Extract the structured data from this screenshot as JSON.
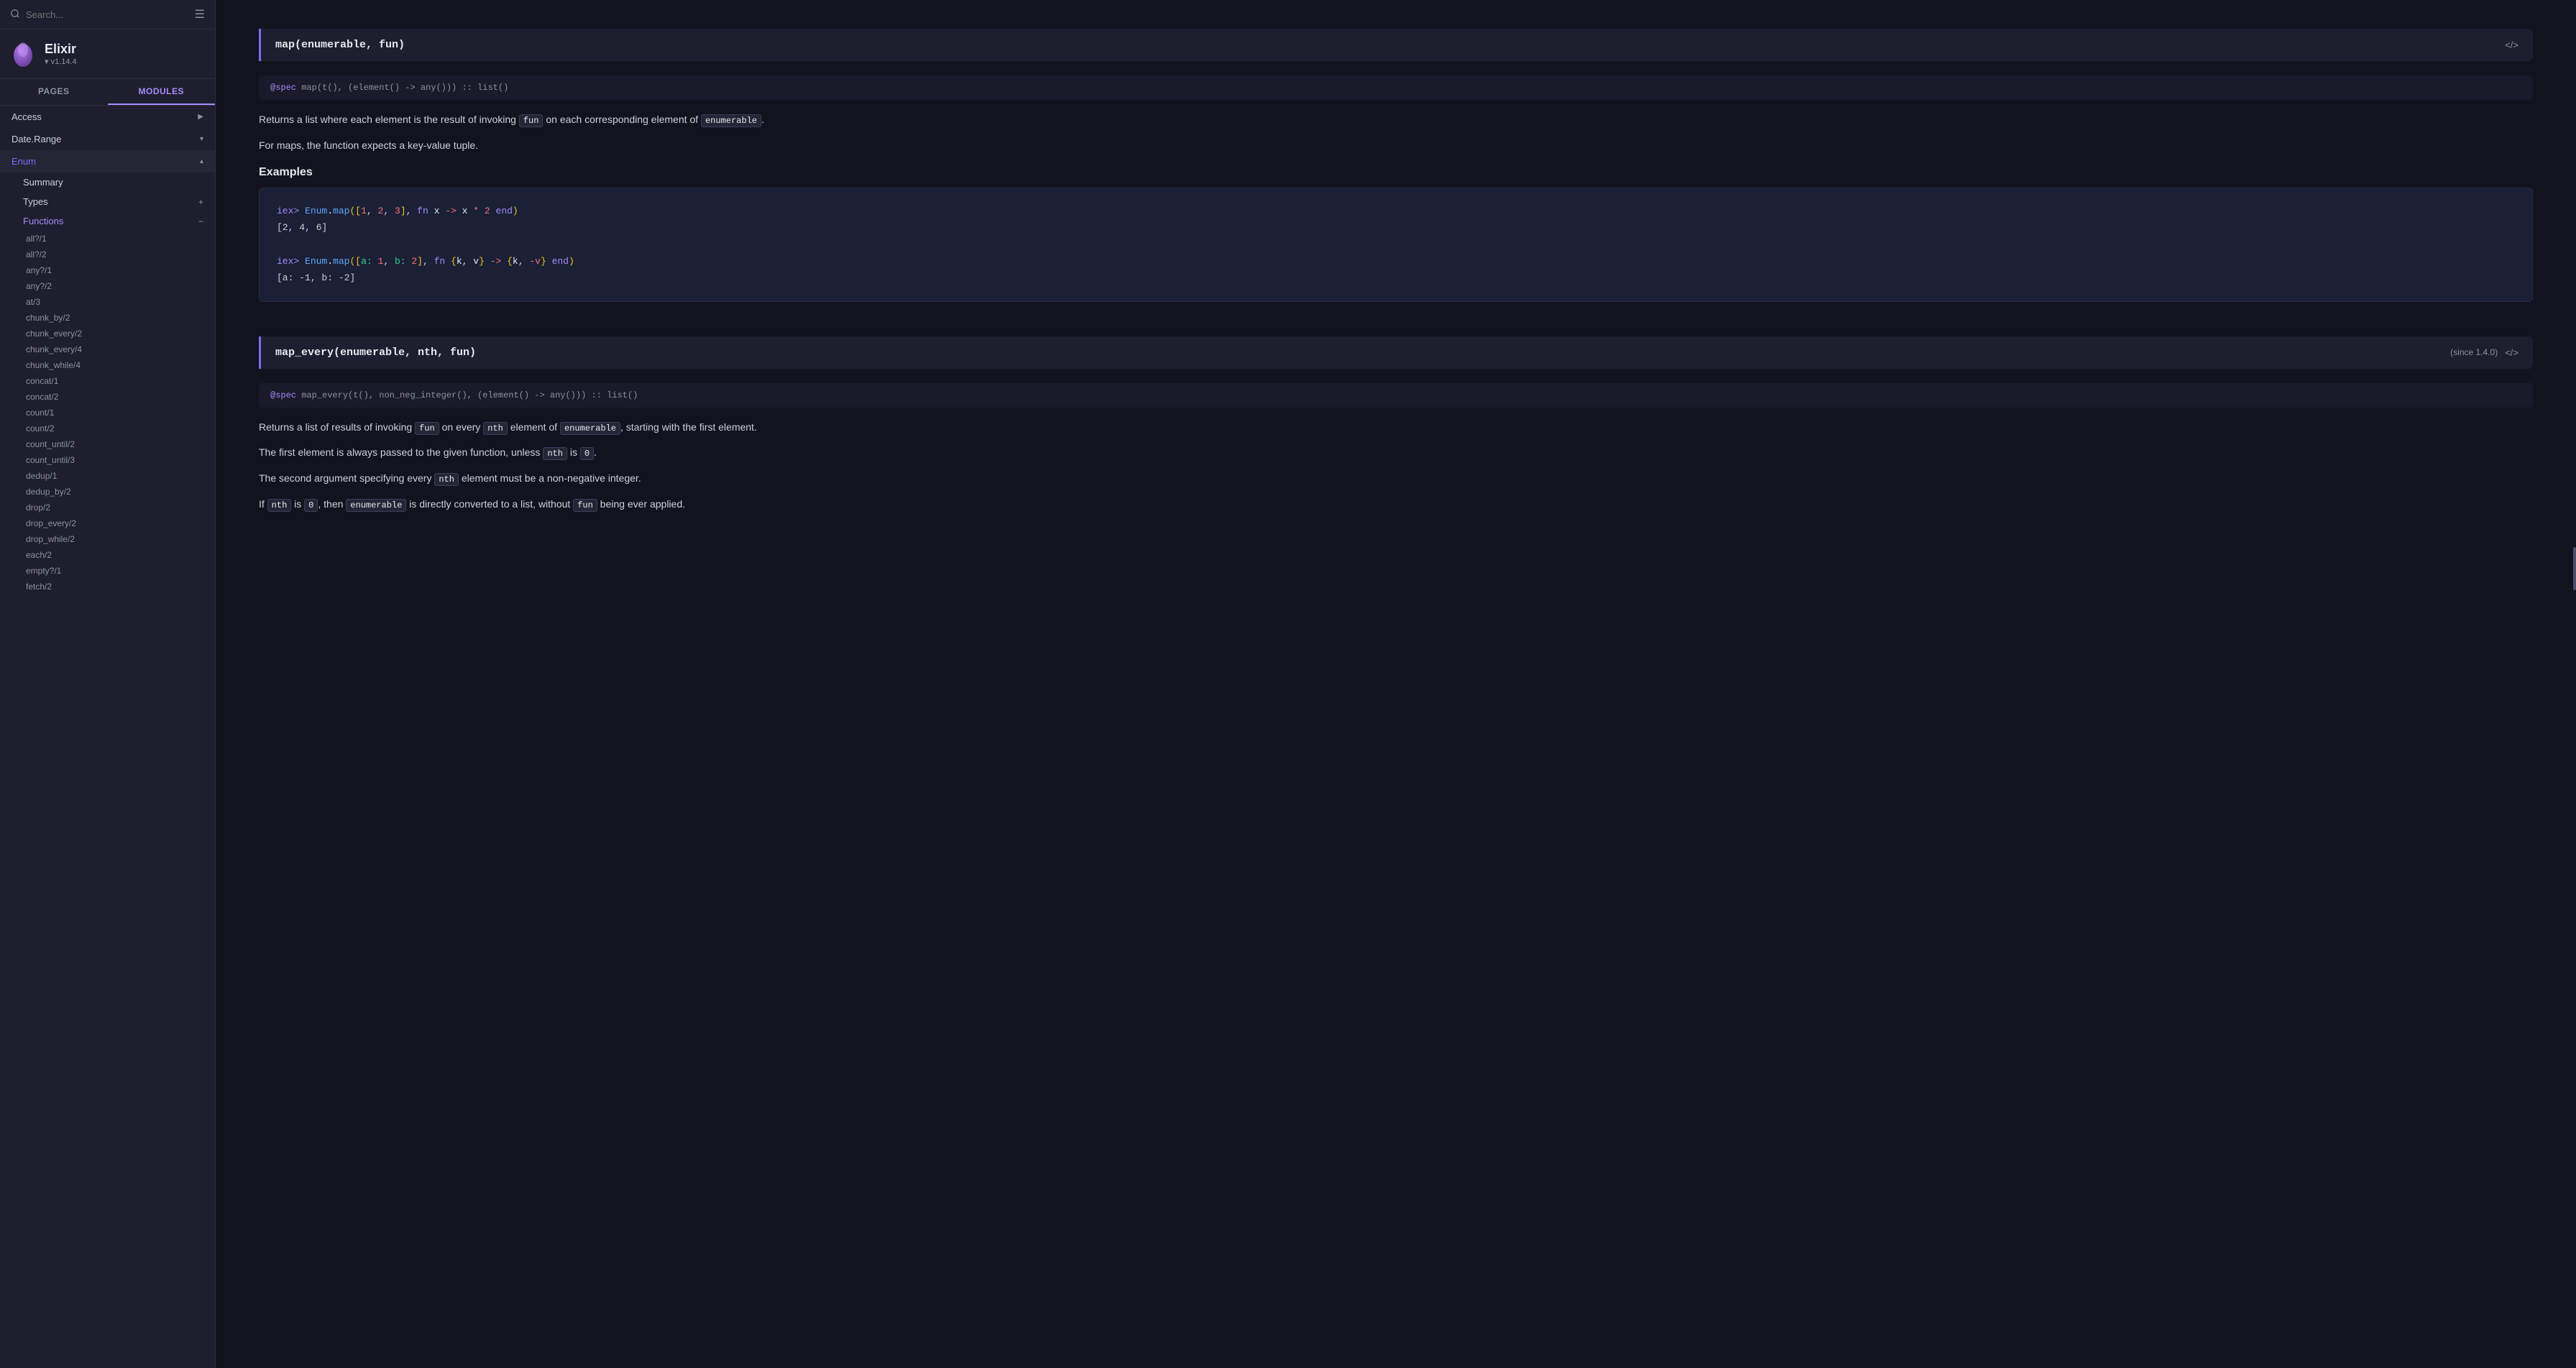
{
  "sidebar": {
    "search_placeholder": "Search...",
    "brand": {
      "name": "Elixir",
      "version": "▾ v1.14.4"
    },
    "tabs": [
      {
        "label": "PAGES",
        "active": false
      },
      {
        "label": "MODULES",
        "active": true
      }
    ],
    "nav_items": [
      {
        "label": "Access",
        "collapsed": true
      },
      {
        "label": "Date.Range",
        "collapsed": true
      },
      {
        "label": "Enum",
        "collapsed": false,
        "active": true
      }
    ],
    "enum_sub_items": [
      {
        "label": "Summary",
        "active": false
      },
      {
        "label": "Types",
        "has_plus": true
      },
      {
        "label": "Functions",
        "has_minus": true,
        "active": true
      }
    ],
    "functions": [
      "all?/1",
      "all?/2",
      "any?/1",
      "any?/2",
      "at/3",
      "chunk_by/2",
      "chunk_every/2",
      "chunk_every/4",
      "chunk_while/4",
      "concat/1",
      "concat/2",
      "count/1",
      "count/2",
      "count_until/2",
      "count_until/3",
      "dedup/1",
      "dedup_by/2",
      "drop/2",
      "drop_every/2",
      "drop_while/2",
      "each/2",
      "empty?/1",
      "fetch/2"
    ]
  },
  "main": {
    "function_blocks": [
      {
        "id": "map",
        "signature": "map(enumerable, fun)",
        "spec": "@spec map(t(), (element() -> any())) :: list()",
        "description_parts": [
          "Returns a list where each element is the result of invoking",
          "fun",
          "on each corresponding element of",
          "enumerable."
        ],
        "for_maps_note": "For maps, the function expects a key-value tuple.",
        "examples_title": "Examples",
        "examples": [
          {
            "input": "iex> Enum.map([1, 2, 3], fn x -> x * 2 end)",
            "output": "[2, 4, 6]"
          },
          {
            "input": "iex> Enum.map([a: 1, b: 2], fn {k, v} -> {k, -v} end)",
            "output": "[a: -1, b: -2]"
          }
        ],
        "since": null,
        "code_link": "</>"
      },
      {
        "id": "map_every",
        "signature": "map_every(enumerable, nth, fun)",
        "spec": "@spec map_every(t(), non_neg_integer(), (element() -> any())) :: list()",
        "since": "(since 1.4.0)",
        "code_link": "</>",
        "description_lines": [
          "Returns a list of results of invoking fun on every nth element of enumerable, starting with the first element.",
          "The first element is always passed to the given function, unless nth is 0.",
          "The second argument specifying every nth element must be a non-negative integer.",
          "If nth is 0, then enumerable is directly converted to a list, without fun being ever applied."
        ],
        "inline_codes": {
          "fun": "fun",
          "nth": "nth",
          "enumerable": "enumerable",
          "zero": "0",
          "enum2": "enumerable",
          "fun2": "fun"
        }
      }
    ]
  }
}
